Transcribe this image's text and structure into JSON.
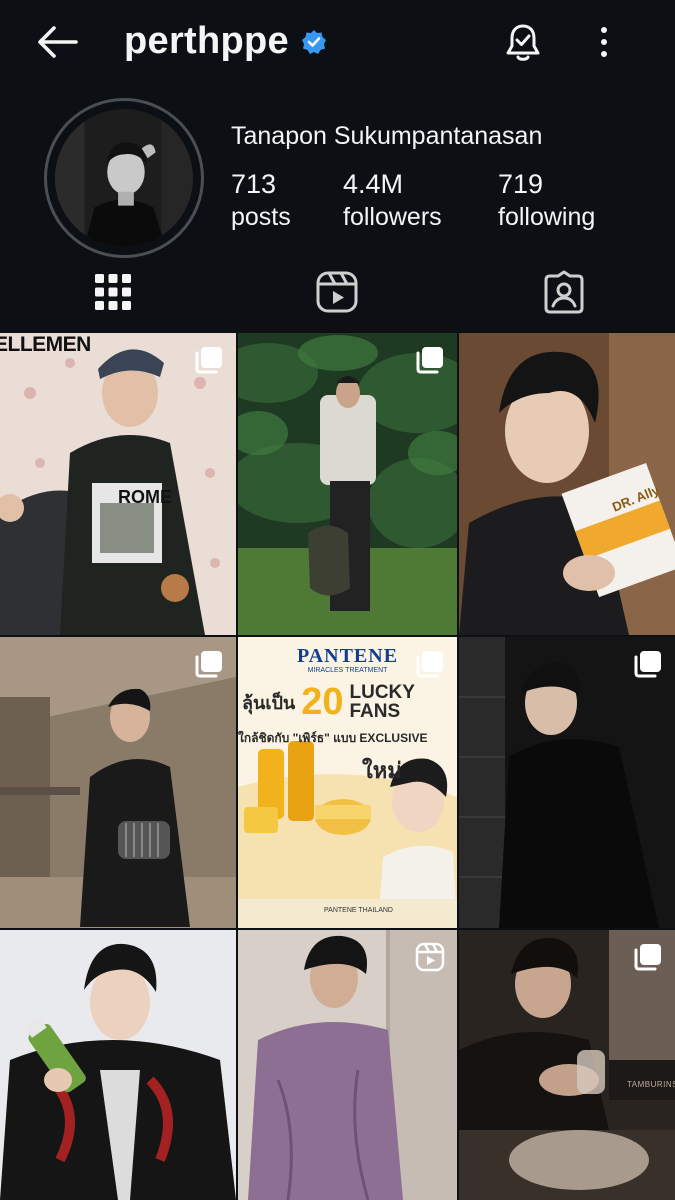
{
  "header": {
    "username": "perthppe",
    "back_icon": "arrow-left-icon",
    "verified_icon": "verified-badge-icon",
    "notifications_icon": "bell-check-icon",
    "more_icon": "more-vertical-icon"
  },
  "profile": {
    "full_name": "Tanapon Sukumpantanasan",
    "stats": [
      {
        "value": "713",
        "label": "posts"
      },
      {
        "value": "4.4M",
        "label": "followers"
      },
      {
        "value": "719",
        "label": "following"
      }
    ]
  },
  "tabs": [
    {
      "icon": "grid-icon",
      "active": true
    },
    {
      "icon": "reels-icon",
      "active": false
    },
    {
      "icon": "tagged-icon",
      "active": false
    }
  ],
  "posts": {
    "p1": {
      "overlay_text": "ELLEMEN",
      "shirt_text": "ROME",
      "badge": "carousel-icon"
    },
    "p2": {
      "badge": "carousel-icon"
    },
    "p3": {
      "product_text": "DR. Ally",
      "badge": "none"
    },
    "p4": {
      "badge": "carousel-icon"
    },
    "p5": {
      "brand": "PANTENE",
      "brand_sub": "MIRACLES TREATMENT",
      "headline_thai": "ลุ้นเป็น",
      "headline_number": "20",
      "headline_lucky": "LUCKY",
      "headline_fans": "FANS",
      "subline": "ใกล้ชิดกับ \"เพิร์ธ\" แบบ EXCLUSIVE",
      "new_tag": "ใหม่",
      "footer": "PANTENE THAILAND",
      "badge": "carousel-icon"
    },
    "p6": {
      "badge": "carousel-icon"
    },
    "p7": {
      "badge": "none"
    },
    "p8": {
      "badge": "reel-icon"
    },
    "p9": {
      "box_text": "TAMBURINS",
      "badge": "carousel-icon"
    }
  },
  "colors": {
    "background": "#0c1014",
    "text": "#f5f5f5",
    "verified": "#3897f0",
    "pantene_gold": "#f2b21c"
  }
}
